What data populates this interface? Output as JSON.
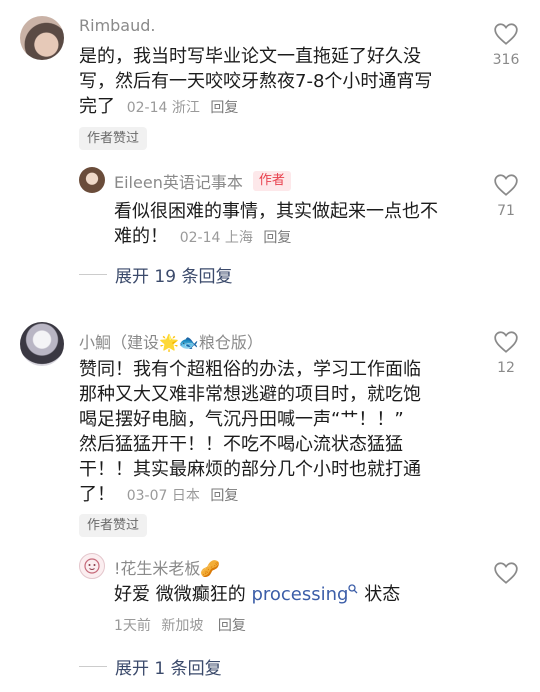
{
  "comments": [
    {
      "name": "Rimbaud.",
      "text_lines": [
        "是的，我当时写毕业论文一直拖延了好久没",
        "写，然后有一天咬咬牙熬夜7-8个小时通宵写"
      ],
      "last_line": "完了",
      "date": "02-14",
      "location": "浙江",
      "reply": "回复",
      "badge": "作者赞过",
      "likes": "316"
    },
    {
      "name": "小鮰（建设🌟🐟粮仓版）",
      "text_lines": [
        "赞同！我有个超粗俗的办法，学习工作面临",
        "那种又大又难非常想逃避的项目时，就吃饱",
        "喝足摆好电脑，气沉丹田喊一声“艹！！”",
        "然后猛猛开干！！不吃不喝心流状态猛猛"
      ],
      "last_line": "干！！其实最麻烦的部分几个小时也就打通",
      "last_line2": "了！",
      "date": "03-07",
      "location": "日本",
      "reply": "回复",
      "badge": "作者赞过",
      "likes": "12"
    }
  ],
  "replies": [
    {
      "name": "Eileen英语记事本",
      "author_tag": "作者",
      "text_line1": "看似很困难的事情，其实做起来一点也不",
      "text_line2": "难的！",
      "date": "02-14",
      "location": "上海",
      "reply": "回复",
      "likes": "71"
    },
    {
      "name": "!花生米老板🥜",
      "text_prefix": "好爱 微微癫狂的 ",
      "text_link": "processing",
      "text_suffix": " 状态",
      "date": "1天前",
      "location": "新加坡",
      "reply": "回复"
    }
  ],
  "expand_labels": [
    "展开 19 条回复",
    "展开 1 条回复"
  ]
}
